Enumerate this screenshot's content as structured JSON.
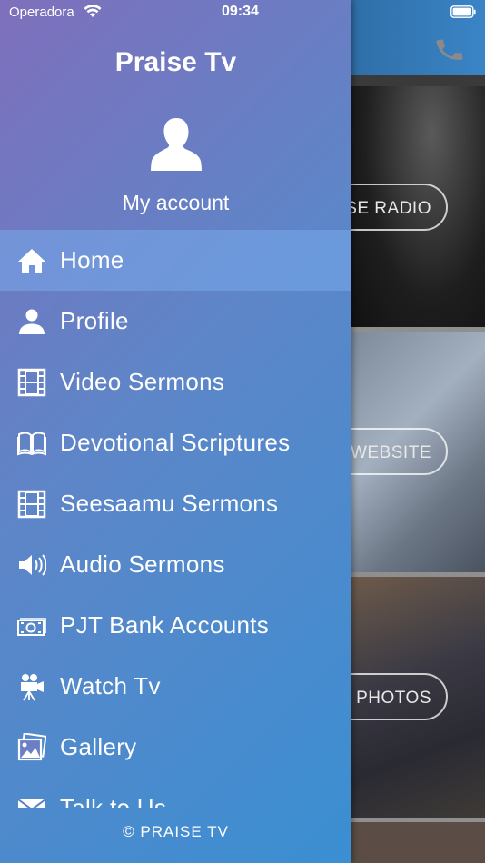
{
  "status_bar": {
    "carrier": "Operadora",
    "time": "09:34"
  },
  "drawer": {
    "title": "Praise Tv",
    "account_label": "My account",
    "menu": [
      {
        "label": "Home",
        "icon": "home-icon",
        "active": true
      },
      {
        "label": "Profile",
        "icon": "person-icon"
      },
      {
        "label": "Video Sermons",
        "icon": "film-icon"
      },
      {
        "label": "Devotional Scriptures",
        "icon": "book-icon"
      },
      {
        "label": "Seesaamu Sermons",
        "icon": "film-icon"
      },
      {
        "label": "Audio Sermons",
        "icon": "speaker-icon"
      },
      {
        "label": "PJT Bank Accounts",
        "icon": "cash-icon"
      },
      {
        "label": "Watch Tv",
        "icon": "camera-icon"
      },
      {
        "label": "Gallery",
        "icon": "photos-icon"
      },
      {
        "label": "Talk to Us",
        "icon": "mail-icon"
      }
    ],
    "footer": "© PRAISE  TV"
  },
  "background": {
    "tiles": [
      {
        "label": "SE RADIO"
      },
      {
        "label": "WEBSITE"
      },
      {
        "label": "PHOTOS"
      }
    ]
  },
  "colors": {
    "drawer_start": "#7f6fbc",
    "drawer_end": "#3a8fd2",
    "active_item": "#78aaeb"
  }
}
